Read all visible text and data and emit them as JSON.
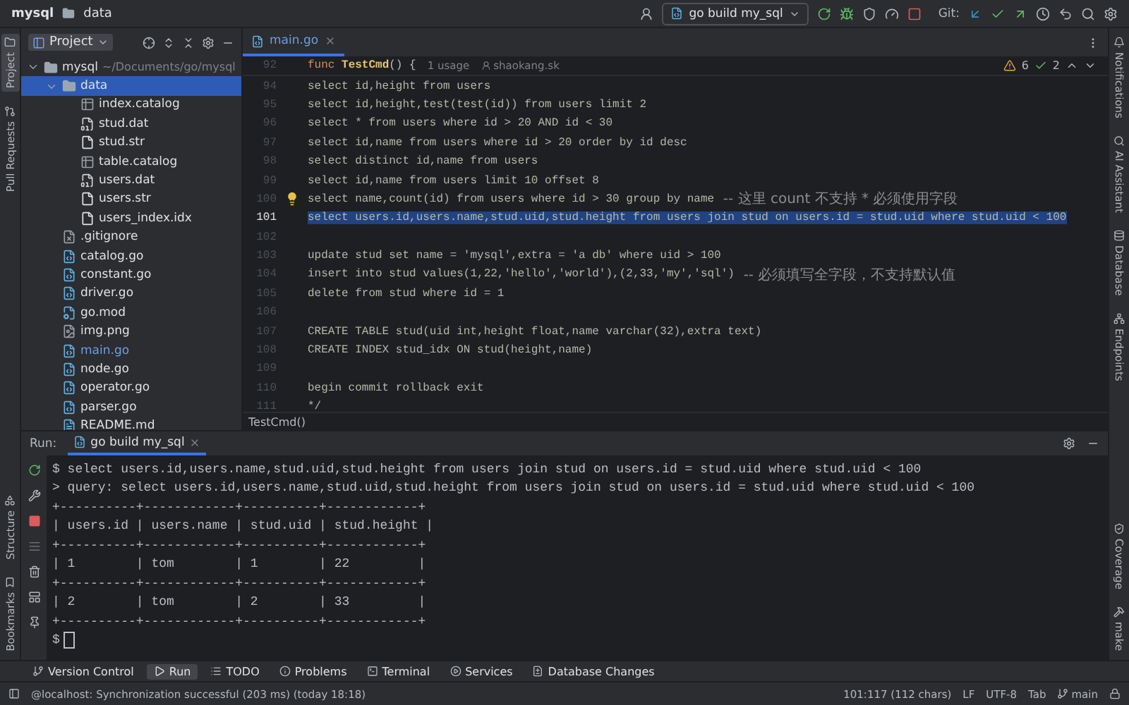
{
  "title_bar": {
    "project": "mysql",
    "folder": "data",
    "run_config": "go build my_sql",
    "git_label": "Git:"
  },
  "left_strip": {
    "top": [
      {
        "label": "Project",
        "selected": true
      },
      {
        "label": "Pull Requests",
        "selected": false
      }
    ],
    "bottom": [
      {
        "label": "Structure",
        "selected": false
      },
      {
        "label": "Bookmarks",
        "selected": false
      }
    ]
  },
  "right_strip": {
    "top": [
      "Notifications",
      "AI Assistant",
      "Database",
      "Endpoints"
    ],
    "bottom": [
      "Coverage",
      "make"
    ]
  },
  "project_panel": {
    "title": "Project",
    "tree": [
      {
        "name": "mysql",
        "path": "~/Documents/go/mysql",
        "kind": "folder",
        "expanded": true,
        "selected": false,
        "modified": false,
        "children": [
          {
            "name": "data",
            "kind": "folder",
            "expanded": true,
            "selected": true,
            "modified": false,
            "children": [
              {
                "name": "index.catalog",
                "kind": "catalog",
                "selected": false,
                "modified": false
              },
              {
                "name": "stud.dat",
                "kind": "binary",
                "selected": false,
                "modified": false
              },
              {
                "name": "stud.str",
                "kind": "text",
                "selected": false,
                "modified": false
              },
              {
                "name": "table.catalog",
                "kind": "catalog",
                "selected": false,
                "modified": false
              },
              {
                "name": "users.dat",
                "kind": "binary",
                "selected": false,
                "modified": false
              },
              {
                "name": "users.str",
                "kind": "text",
                "selected": false,
                "modified": false
              },
              {
                "name": "users_index.idx",
                "kind": "text",
                "selected": false,
                "modified": false
              }
            ]
          },
          {
            "name": ".gitignore",
            "kind": "ignore",
            "selected": false,
            "modified": false
          },
          {
            "name": "catalog.go",
            "kind": "go",
            "selected": false,
            "modified": false
          },
          {
            "name": "constant.go",
            "kind": "go",
            "selected": false,
            "modified": false
          },
          {
            "name": "driver.go",
            "kind": "go",
            "selected": false,
            "modified": false
          },
          {
            "name": "go.mod",
            "kind": "mod",
            "selected": false,
            "modified": false
          },
          {
            "name": "img.png",
            "kind": "image",
            "selected": false,
            "modified": false
          },
          {
            "name": "main.go",
            "kind": "go",
            "selected": false,
            "modified": true
          },
          {
            "name": "node.go",
            "kind": "go",
            "selected": false,
            "modified": false
          },
          {
            "name": "operator.go",
            "kind": "go",
            "selected": false,
            "modified": false
          },
          {
            "name": "parser.go",
            "kind": "go",
            "selected": false,
            "modified": false
          },
          {
            "name": "README.md",
            "kind": "markdown",
            "selected": false,
            "modified": false
          }
        ]
      }
    ]
  },
  "editor": {
    "tab": {
      "label": "main.go",
      "selected": true
    },
    "sticky": {
      "number": "92",
      "keyword": "func",
      "name": "TestCmd",
      "rest": "() {",
      "usages": "1 usage",
      "author": "shaokang.sk"
    },
    "inspections": {
      "warnings": "6",
      "ok": "2"
    },
    "lines": [
      {
        "number": "94",
        "code": "select id,height from users",
        "selected": false,
        "bulb": false
      },
      {
        "number": "95",
        "code": "select id,height,test(test(id)) from users limit 2",
        "selected": false,
        "bulb": false
      },
      {
        "number": "96",
        "code": "select * from users where id > 20 AND id < 30",
        "selected": false,
        "bulb": false
      },
      {
        "number": "97",
        "code": "select id,name from users where id > 20 order by id desc",
        "selected": false,
        "bulb": false
      },
      {
        "number": "98",
        "code": "select distinct id,name from users",
        "selected": false,
        "bulb": false
      },
      {
        "number": "99",
        "code": "select id,name from users limit 10 offset 8",
        "selected": false,
        "bulb": false
      },
      {
        "number": "100",
        "code": "select name,count(id) from users where id > 30 group by name",
        "comment": "-- 这里 count 不支持 * 必须使用字段",
        "selected": false,
        "bulb": true
      },
      {
        "number": "101",
        "code": "select users.id,users.name,stud.uid,stud.height from users join stud on users.id = stud.uid where stud.uid < 100",
        "selected": true,
        "bulb": false
      },
      {
        "number": "102",
        "selected": false,
        "bulb": false
      },
      {
        "number": "103",
        "code": "update stud set name = 'mysql',extra = 'a db' where uid > 100",
        "selected": false,
        "bulb": false
      },
      {
        "number": "104",
        "code": "insert into stud values(1,22,'hello','world'),(2,33,'my','sql')",
        "comment": "-- 必须填写全字段，不支持默认值",
        "selected": false,
        "bulb": false
      },
      {
        "number": "105",
        "code": "delete from stud where id = 1",
        "selected": false,
        "bulb": false
      },
      {
        "number": "106",
        "selected": false,
        "bulb": false
      },
      {
        "number": "107",
        "code": "CREATE TABLE stud(uid int,height float,name varchar(32),extra text)",
        "selected": false,
        "bulb": false
      },
      {
        "number": "108",
        "code": "CREATE INDEX stud_idx ON stud(height,name)",
        "selected": false,
        "bulb": false
      },
      {
        "number": "109",
        "selected": false,
        "bulb": false
      },
      {
        "number": "110",
        "code": "begin commit rollback exit",
        "selected": false,
        "bulb": false
      },
      {
        "number": "111",
        "code": "*/",
        "selected": false,
        "bulb": false
      }
    ],
    "breadcrumb": "TestCmd()"
  },
  "run_panel": {
    "label": "Run:",
    "tab": "go build my_sql",
    "output": [
      {
        "kind": "text",
        "text": "$ select users.id,users.name,stud.uid,stud.height from users join stud on users.id = stud.uid where stud.uid < 100"
      },
      {
        "kind": "text",
        "text": "> query: select users.id,users.name,stud.uid,stud.height from users join stud on users.id = stud.uid where stud.uid < 100"
      },
      {
        "kind": "text",
        "text": "+----------+------------+----------+------------+"
      },
      {
        "kind": "text",
        "text": "| users.id | users.name | stud.uid | stud.height |"
      },
      {
        "kind": "text",
        "text": "+----------+------------+----------+------------+"
      },
      {
        "kind": "text",
        "text": "| 1        | tom        | 1        | 22         |"
      },
      {
        "kind": "text",
        "text": "+----------+------------+----------+------------+"
      },
      {
        "kind": "text",
        "text": "| 2        | tom        | 2        | 33         |"
      },
      {
        "kind": "text",
        "text": "+----------+------------+----------+------------+"
      },
      {
        "kind": "prompt",
        "text": "$"
      }
    ]
  },
  "tool_tabs": [
    {
      "label": "Version Control",
      "kind": "vcs",
      "selected": false
    },
    {
      "label": "Run",
      "kind": "run",
      "selected": true
    },
    {
      "label": "TODO",
      "kind": "todo",
      "selected": false
    },
    {
      "label": "Problems",
      "kind": "problems",
      "selected": false
    },
    {
      "label": "Terminal",
      "kind": "terminal",
      "selected": false
    },
    {
      "label": "Services",
      "kind": "services",
      "selected": false
    },
    {
      "label": "Database Changes",
      "kind": "dbchanges",
      "selected": false
    }
  ],
  "status_bar": {
    "message": "@localhost: Synchronization successful (203 ms) (today 18:18)",
    "position": "101:117 (112 chars)",
    "line_separator": "LF",
    "encoding": "UTF-8",
    "indent": "Tab",
    "branch": "main"
  }
}
